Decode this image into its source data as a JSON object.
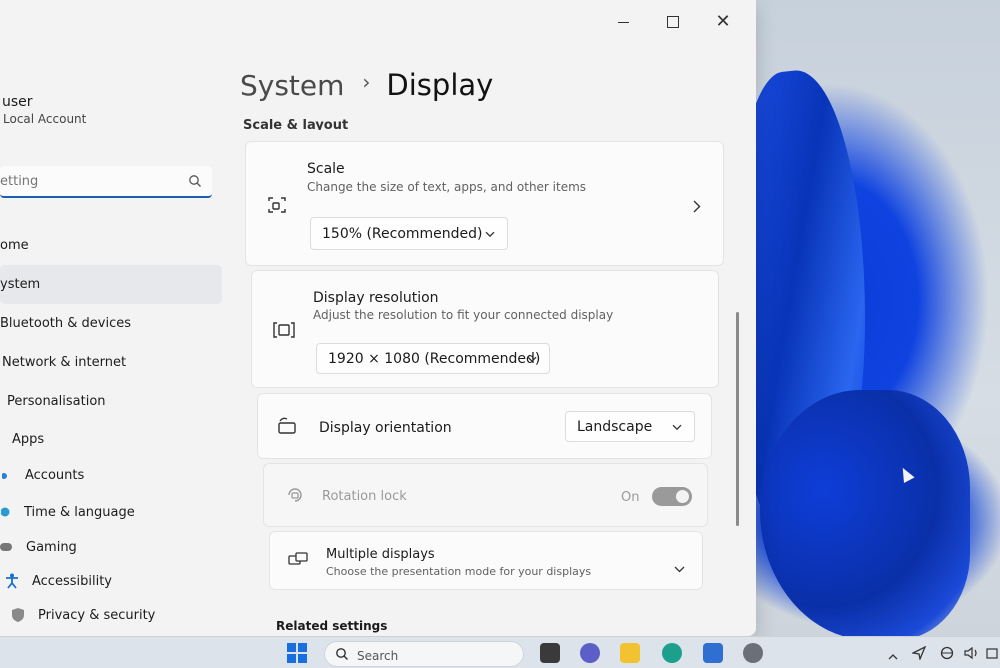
{
  "window": {
    "controls": {
      "minimize": "minimize",
      "maximize": "maximize",
      "close": "✕"
    }
  },
  "sidebar": {
    "user_name": "user",
    "account_type": "Local Account",
    "search_placeholder": "etting",
    "items": [
      {
        "label": "ome",
        "icon": "home-icon"
      },
      {
        "label": "ystem",
        "icon": "system-icon",
        "active": true
      },
      {
        "label": "Bluetooth & devices",
        "icon": "bluetooth-icon"
      },
      {
        "label": "Network & internet",
        "icon": "wifi-icon"
      },
      {
        "label": "Personalisation",
        "icon": "brush-icon"
      },
      {
        "label": "Apps",
        "icon": "apps-icon"
      },
      {
        "label": "Accounts",
        "icon": "person-icon"
      },
      {
        "label": "Time & language",
        "icon": "globe-icon"
      },
      {
        "label": "Gaming",
        "icon": "controller-icon"
      },
      {
        "label": "Accessibility",
        "icon": "accessibility-icon"
      },
      {
        "label": "Privacy & security",
        "icon": "shield-icon"
      }
    ]
  },
  "main": {
    "breadcrumb": {
      "parent": "System",
      "separator": "›",
      "current": "Display"
    },
    "section_title": "Scale & layout",
    "scale": {
      "title": "Scale",
      "subtitle": "Change the size of text, apps, and other items",
      "value": "150% (Recommended)"
    },
    "resolution": {
      "title": "Display resolution",
      "subtitle": "Adjust the resolution to fit your connected display",
      "value": "1920 × 1080 (Recommended)"
    },
    "orientation": {
      "title": "Display orientation",
      "value": "Landscape"
    },
    "rotation_lock": {
      "title": "Rotation lock",
      "state": "On"
    },
    "multiple_displays": {
      "title": "Multiple displays",
      "subtitle": "Choose the presentation mode for your displays"
    },
    "related_settings": "Related settings"
  },
  "taskbar": {
    "search_label": "Search"
  },
  "colors": {
    "accent": "#1a5fb4",
    "window_bg": "#f3f3f3",
    "card_bg": "#fbfbfb",
    "wallpaper_blue": "#0a3bd6"
  }
}
